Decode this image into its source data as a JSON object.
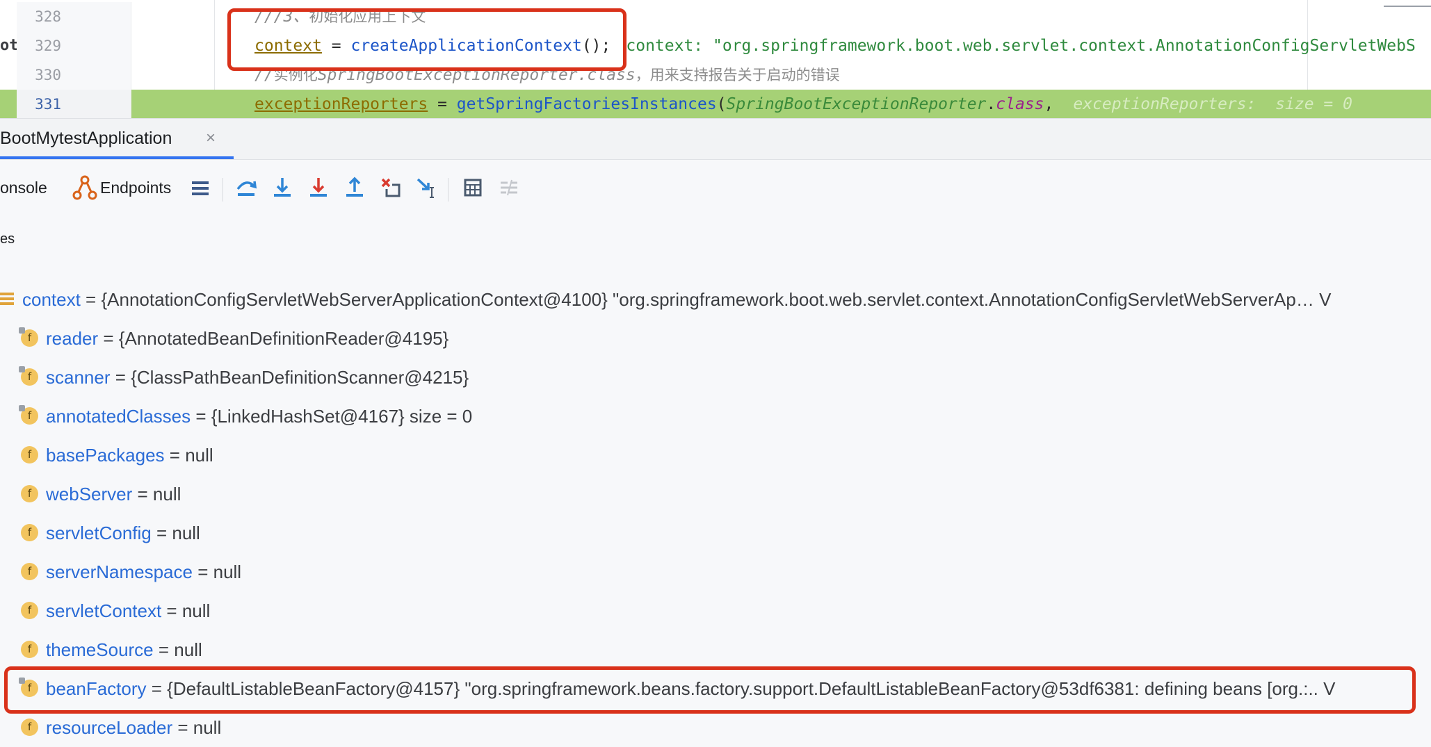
{
  "editor": {
    "left_edge_text": "ot·",
    "lines": [
      {
        "num": "328",
        "comment": "///3、",
        "comment_cjk": "初始化应用上下文"
      },
      {
        "num": "329",
        "var": "context",
        "op": " = ",
        "method": "createApplicationContext",
        "tail": "();",
        "hint": "context: \"org.springframework.boot.web.servlet.context.AnnotationConfigServletWebS"
      },
      {
        "num": "330",
        "comment": "//",
        "comment_cjk_pre": "实例化",
        "comment_mid": "SpringBootExceptionReporter.class",
        "comment_cjk": "，用来支持报告关于启动的错误"
      },
      {
        "num": "331",
        "var": "exceptionReporters",
        "op": " = ",
        "method": "getSpringFactoriesInstances",
        "paren": "(",
        "cls": "SpringBootExceptionReporter",
        "dot": ".",
        "kw": "class",
        "comma": ",",
        "hint": "exceptionReporters:  size = 0"
      }
    ]
  },
  "tabs": [
    {
      "label": "BootMytestApplication",
      "close": "×"
    }
  ],
  "toolbar": {
    "console_label": "onsole",
    "endpoints_label": "Endpoints"
  },
  "variables": {
    "header": "es",
    "root": {
      "name": "context",
      "rest": " = {AnnotationConfigServletWebServerApplicationContext@4100} \"org.springframework.boot.web.servlet.context.AnnotationConfigServletWebServerAp… V"
    },
    "fields": [
      {
        "name": "reader",
        "rest": " = {AnnotatedBeanDefinitionReader@4195}"
      },
      {
        "name": "scanner",
        "rest": " = {ClassPathBeanDefinitionScanner@4215}"
      },
      {
        "name": "annotatedClasses",
        "rest": " = {LinkedHashSet@4167}  size = 0"
      },
      {
        "name": "basePackages",
        "rest": " = null"
      },
      {
        "name": "webServer",
        "rest": " = null"
      },
      {
        "name": "servletConfig",
        "rest": " = null"
      },
      {
        "name": "serverNamespace",
        "rest": " = null"
      },
      {
        "name": "servletContext",
        "rest": " = null"
      },
      {
        "name": "themeSource",
        "rest": " = null"
      },
      {
        "name": "beanFactory",
        "rest": " = {DefaultListableBeanFactory@4157} \"org.springframework.beans.factory.support.DefaultListableBeanFactory@53df6381: defining beans [org.:.. V"
      },
      {
        "name": "resourceLoader",
        "rest": " = null"
      }
    ],
    "field_icon_letter": "f"
  },
  "colors": {
    "highlight_box": "#d9311a",
    "current_line": "#a6d176",
    "field_name": "#2a6bd6",
    "tab_underline": "#3574f0"
  }
}
